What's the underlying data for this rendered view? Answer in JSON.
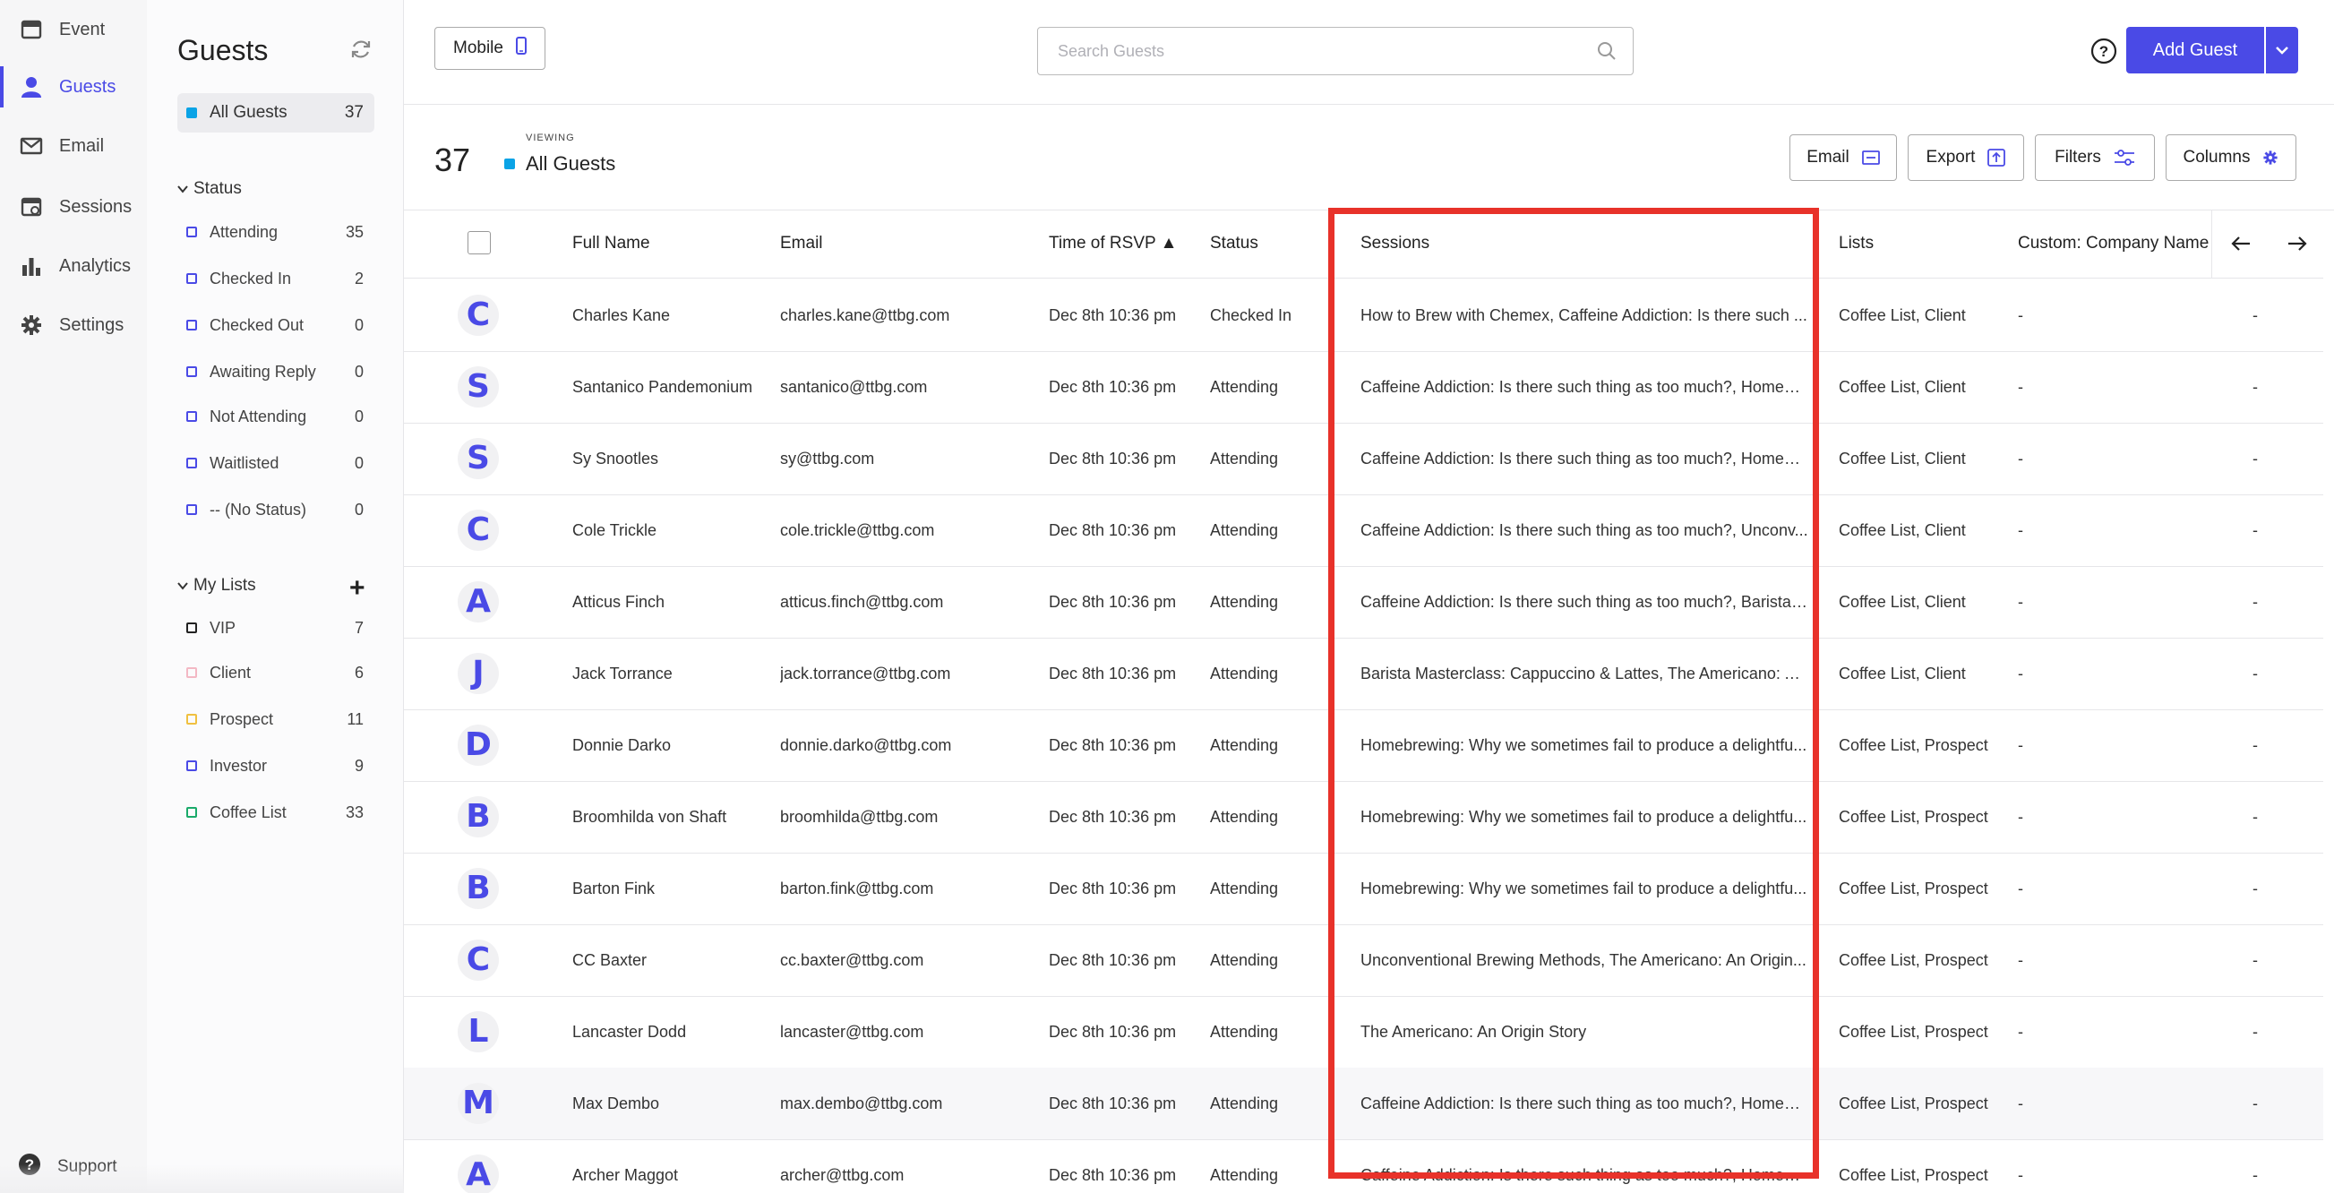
{
  "nav": {
    "items": [
      {
        "label": "Event",
        "icon": "calendar-icon",
        "active": false
      },
      {
        "label": "Guests",
        "icon": "person-icon",
        "active": true
      },
      {
        "label": "Email",
        "icon": "envelope-icon",
        "active": false
      },
      {
        "label": "Sessions",
        "icon": "sessions-icon",
        "active": false
      },
      {
        "label": "Analytics",
        "icon": "bar-chart-icon",
        "active": false
      },
      {
        "label": "Settings",
        "icon": "gear-icon",
        "active": false
      }
    ],
    "support": "Support"
  },
  "sidebar": {
    "title": "Guests",
    "all_guests": {
      "label": "All Guests",
      "count": "37"
    },
    "status_header": "Status",
    "statuses": [
      {
        "label": "Attending",
        "count": "35"
      },
      {
        "label": "Checked In",
        "count": "2"
      },
      {
        "label": "Checked Out",
        "count": "0"
      },
      {
        "label": "Awaiting Reply",
        "count": "0"
      },
      {
        "label": "Not Attending",
        "count": "0"
      },
      {
        "label": "Waitlisted",
        "count": "0"
      },
      {
        "label": "-- (No Status)",
        "count": "0"
      }
    ],
    "lists_header": "My Lists",
    "lists": [
      {
        "label": "VIP",
        "count": "7",
        "color": "#222222"
      },
      {
        "label": "Client",
        "count": "6",
        "color": "#f3b8c4"
      },
      {
        "label": "Prospect",
        "count": "11",
        "color": "#f0c040"
      },
      {
        "label": "Investor",
        "count": "9",
        "color": "#4a4ae6"
      },
      {
        "label": "Coffee List",
        "count": "33",
        "color": "#1aaa6a"
      }
    ]
  },
  "topbar": {
    "mobile_label": "Mobile",
    "search_placeholder": "Search Guests",
    "add_guest": "Add Guest"
  },
  "subbar": {
    "count": "37",
    "viewing_label": "VIEWING",
    "view_name": "All Guests",
    "buttons": {
      "email": "Email",
      "export": "Export",
      "filters": "Filters",
      "columns": "Columns"
    }
  },
  "table": {
    "columns": [
      "Full Name",
      "Email",
      "Time of RSVP ▲",
      "Status",
      "Sessions",
      "Lists",
      "Custom: Company Name"
    ],
    "rows": [
      {
        "avatar": "C",
        "name": "Charles Kane",
        "email": "charles.kane@ttbg.com",
        "time": "Dec 8th 10:36 pm",
        "status": "Checked In",
        "sessions": "How to Brew with Chemex, Caffeine Addiction: Is there such ...",
        "lists": "Coffee List, Client",
        "company": "-",
        "extra": "-"
      },
      {
        "avatar": "S",
        "name": "Santanico Pandemonium",
        "email": "santanico@ttbg.com",
        "time": "Dec 8th 10:36 pm",
        "status": "Attending",
        "sessions": "Caffeine Addiction: Is there such thing as too much?, Homebr...",
        "lists": "Coffee List, Client",
        "company": "-",
        "extra": "-"
      },
      {
        "avatar": "S",
        "name": "Sy Snootles",
        "email": "sy@ttbg.com",
        "time": "Dec 8th 10:36 pm",
        "status": "Attending",
        "sessions": "Caffeine Addiction: Is there such thing as too much?, Homebr...",
        "lists": "Coffee List, Client",
        "company": "-",
        "extra": "-"
      },
      {
        "avatar": "C",
        "name": "Cole Trickle",
        "email": "cole.trickle@ttbg.com",
        "time": "Dec 8th 10:36 pm",
        "status": "Attending",
        "sessions": "Caffeine Addiction: Is there such thing as too much?, Unconv...",
        "lists": "Coffee List, Client",
        "company": "-",
        "extra": "-"
      },
      {
        "avatar": "A",
        "name": "Atticus Finch",
        "email": "atticus.finch@ttbg.com",
        "time": "Dec 8th 10:36 pm",
        "status": "Attending",
        "sessions": "Caffeine Addiction: Is there such thing as too much?, Barista ...",
        "lists": "Coffee List, Client",
        "company": "-",
        "extra": "-"
      },
      {
        "avatar": "J",
        "name": "Jack Torrance",
        "email": "jack.torrance@ttbg.com",
        "time": "Dec 8th 10:36 pm",
        "status": "Attending",
        "sessions": "Barista Masterclass: Cappuccino & Lattes, The Americano: An...",
        "lists": "Coffee List, Client",
        "company": "-",
        "extra": "-"
      },
      {
        "avatar": "D",
        "name": "Donnie Darko",
        "email": "donnie.darko@ttbg.com",
        "time": "Dec 8th 10:36 pm",
        "status": "Attending",
        "sessions": "Homebrewing: Why we sometimes fail to produce a delightfu...",
        "lists": "Coffee List, Prospect",
        "company": "-",
        "extra": "-"
      },
      {
        "avatar": "B",
        "name": "Broomhilda von Shaft",
        "email": "broomhilda@ttbg.com",
        "time": "Dec 8th 10:36 pm",
        "status": "Attending",
        "sessions": "Homebrewing: Why we sometimes fail to produce a delightfu...",
        "lists": "Coffee List, Prospect",
        "company": "-",
        "extra": "-"
      },
      {
        "avatar": "B",
        "name": "Barton Fink",
        "email": "barton.fink@ttbg.com",
        "time": "Dec 8th 10:36 pm",
        "status": "Attending",
        "sessions": "Homebrewing: Why we sometimes fail to produce a delightfu...",
        "lists": "Coffee List, Prospect",
        "company": "-",
        "extra": "-"
      },
      {
        "avatar": "C",
        "name": "CC Baxter",
        "email": "cc.baxter@ttbg.com",
        "time": "Dec 8th 10:36 pm",
        "status": "Attending",
        "sessions": "Unconventional Brewing Methods, The Americano: An Origin...",
        "lists": "Coffee List, Prospect",
        "company": "-",
        "extra": "-"
      },
      {
        "avatar": "L",
        "name": "Lancaster Dodd",
        "email": "lancaster@ttbg.com",
        "time": "Dec 8th 10:36 pm",
        "status": "Attending",
        "sessions": "The Americano: An Origin Story",
        "lists": "Coffee List, Prospect",
        "company": "-",
        "extra": "-"
      },
      {
        "avatar": "M",
        "name": "Max Dembo",
        "email": "max.dembo@ttbg.com",
        "time": "Dec 8th 10:36 pm",
        "status": "Attending",
        "sessions": "Caffeine Addiction: Is there such thing as too much?, Homebr...",
        "lists": "Coffee List, Prospect",
        "company": "-",
        "extra": "-"
      },
      {
        "avatar": "A",
        "name": "Archer Maggot",
        "email": "archer@ttbg.com",
        "time": "Dec 8th 10:36 pm",
        "status": "Attending",
        "sessions": "Caffeine Addiction: Is there such thing as too much?, Homebr...",
        "lists": "Coffee List, Prospect",
        "company": "-",
        "extra": "-"
      }
    ]
  },
  "colors": {
    "accent": "#4a4ae6",
    "highlight": "#e8322a",
    "all_guests_dot": "#0aa3e6"
  }
}
